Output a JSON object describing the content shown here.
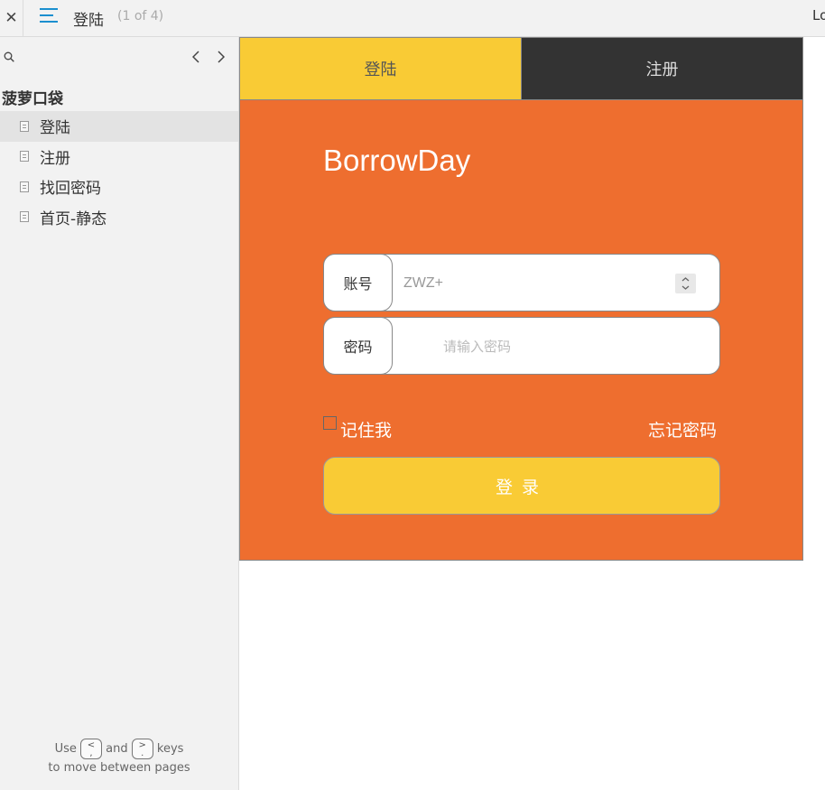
{
  "topbar": {
    "close_glyph": "✕",
    "page_title": "登陆",
    "page_count": "(1 of 4)",
    "right_text": "Lo"
  },
  "sidebar": {
    "project_title": "菠萝口袋",
    "pages": [
      {
        "label": "登陆",
        "active": true
      },
      {
        "label": "注册",
        "active": false
      },
      {
        "label": "找回密码",
        "active": false
      },
      {
        "label": "首页-静态",
        "active": false
      }
    ],
    "hint": {
      "use": "Use",
      "and": "and",
      "keys": "keys",
      "line2": "to move between pages",
      "key_prev_top": "<",
      "key_prev_bottom": ",",
      "key_next_top": ">",
      "key_next_bottom": "."
    }
  },
  "tabs": {
    "login": "登陆",
    "register": "注册"
  },
  "form": {
    "brand": "BorrowDay",
    "account_label": "账号",
    "account_value": "ZWZ+",
    "password_label": "密码",
    "password_placeholder": "请输入密码",
    "remember_label": "记住我",
    "forgot_label": "忘记密码",
    "submit_label": "登录"
  },
  "colors": {
    "accent_blue": "#1b8fcf",
    "tab_active": "#f9cb35",
    "tab_inactive": "#333333",
    "panel_orange": "#ee6e2f",
    "button_yellow": "#f9cb35"
  },
  "icons": {
    "close": "close-icon",
    "menu": "menu-icon",
    "search": "search-icon",
    "prev": "chevron-left-icon",
    "next": "chevron-right-icon",
    "page": "page-icon",
    "spinner": "spinner-icon"
  }
}
